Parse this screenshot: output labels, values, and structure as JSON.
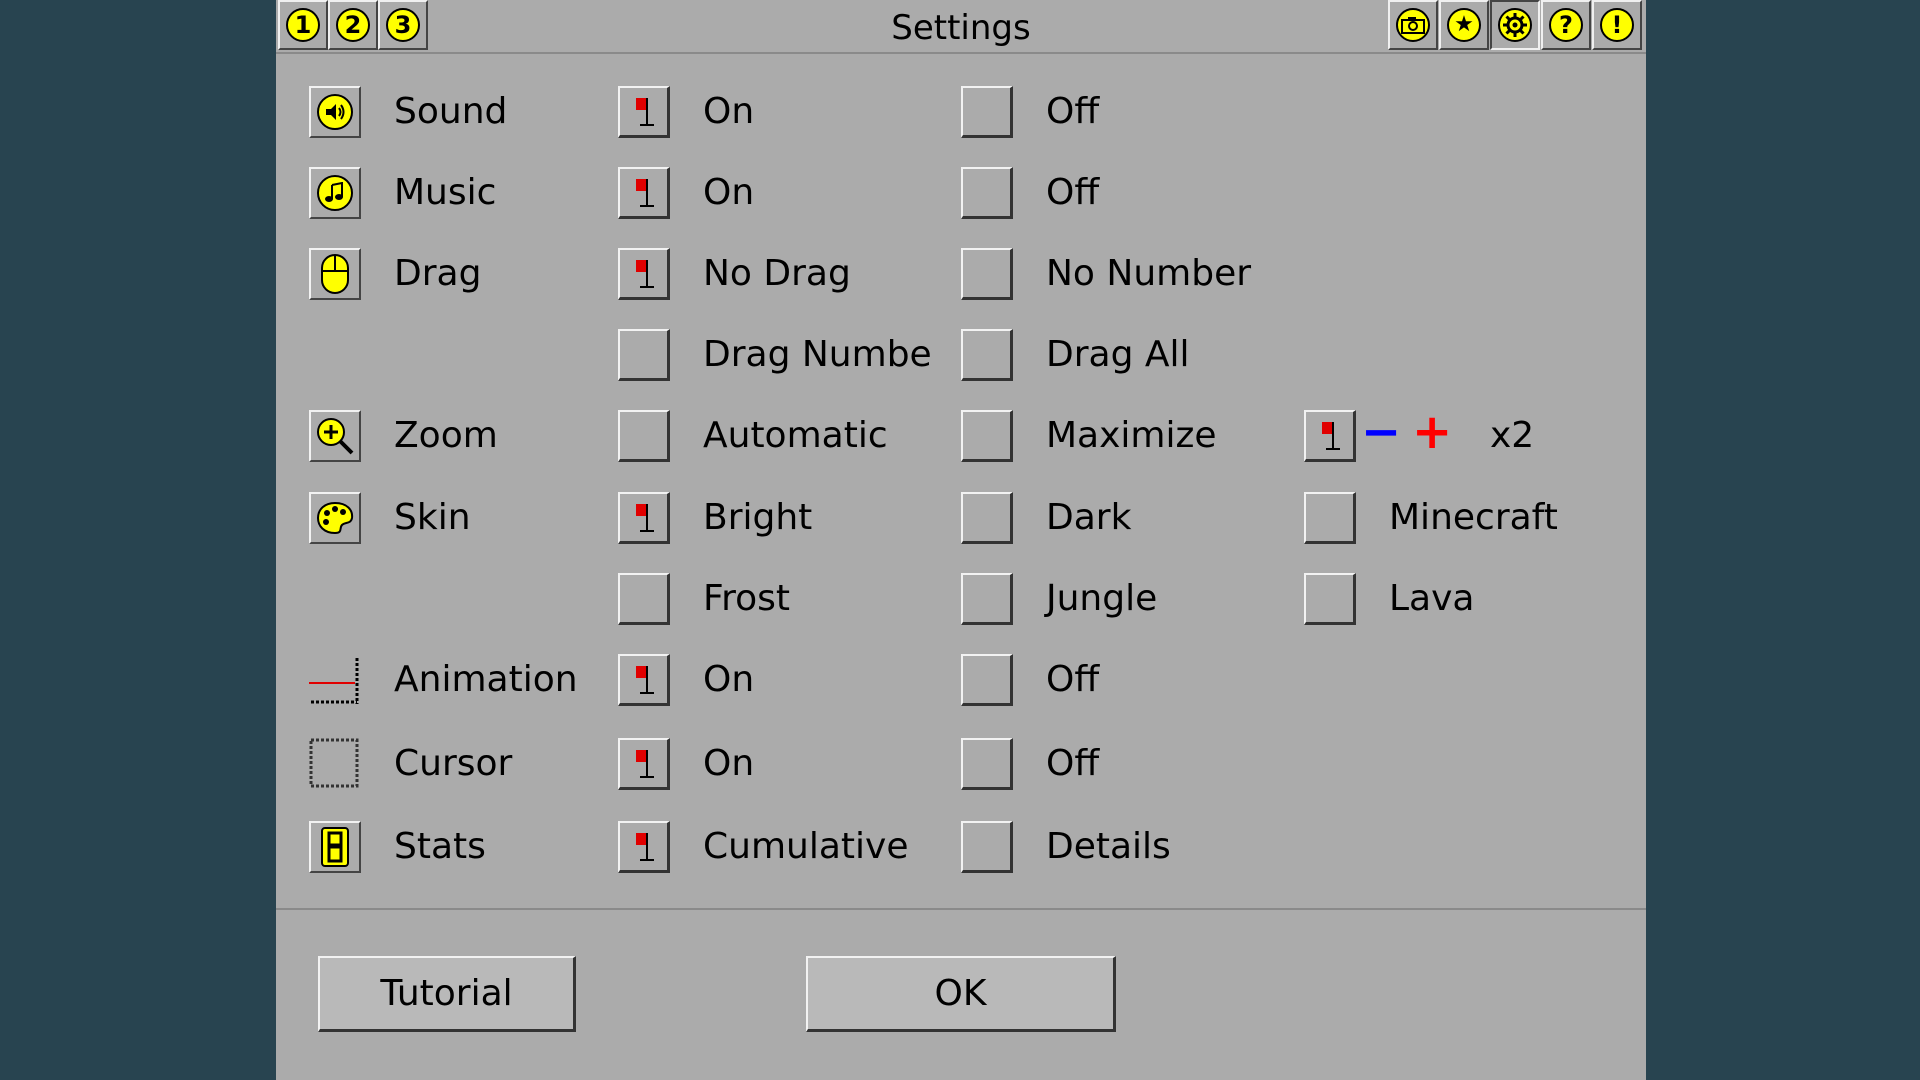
{
  "title": "Settings",
  "titlebar": {
    "left_buttons": [
      "1",
      "2",
      "3"
    ],
    "right_icons": [
      "camera-icon",
      "star-icon",
      "gear-icon",
      "help-icon",
      "alert-icon"
    ],
    "right_symbols": [
      "◎",
      "★",
      "✺",
      "?",
      "!"
    ]
  },
  "rows": {
    "sound": {
      "label": "Sound",
      "icon": "speaker-icon",
      "options": [
        {
          "label": "On",
          "checked": true
        },
        {
          "label": "Off",
          "checked": false
        }
      ]
    },
    "music": {
      "label": "Music",
      "icon": "music-note-icon",
      "options": [
        {
          "label": "On",
          "checked": true
        },
        {
          "label": "Off",
          "checked": false
        }
      ]
    },
    "drag": {
      "label": "Drag",
      "icon": "mouse-icon",
      "options": [
        {
          "label": "No Drag",
          "checked": true
        },
        {
          "label": "No Number",
          "checked": false
        },
        {
          "label": "Drag Numbe",
          "checked": false
        },
        {
          "label": "Drag All",
          "checked": false
        }
      ]
    },
    "zoom": {
      "label": "Zoom",
      "icon": "magnifier-icon",
      "options": [
        {
          "label": "Automatic",
          "checked": false
        },
        {
          "label": "Maximize",
          "checked": false
        },
        {
          "label": "",
          "checked": true
        }
      ],
      "minus": "−",
      "plus": "+",
      "value": "x2"
    },
    "skin": {
      "label": "Skin",
      "icon": "palette-icon",
      "options": [
        {
          "label": "Bright",
          "checked": true
        },
        {
          "label": "Dark",
          "checked": false
        },
        {
          "label": "Minecraft",
          "checked": false
        },
        {
          "label": "Frost",
          "checked": false
        },
        {
          "label": "Jungle",
          "checked": false
        },
        {
          "label": "Lava",
          "checked": false
        }
      ]
    },
    "animation": {
      "label": "Animation",
      "icon": "animation-icon",
      "options": [
        {
          "label": "On",
          "checked": true
        },
        {
          "label": "Off",
          "checked": false
        }
      ]
    },
    "cursor": {
      "label": "Cursor",
      "icon": "cursor-box-icon",
      "options": [
        {
          "label": "On",
          "checked": true
        },
        {
          "label": "Off",
          "checked": false
        }
      ]
    },
    "stats": {
      "label": "Stats",
      "icon": "digit-eight-icon",
      "options": [
        {
          "label": "Cumulative",
          "checked": true
        },
        {
          "label": "Details",
          "checked": false
        }
      ]
    }
  },
  "buttons": {
    "tutorial": "Tutorial",
    "ok": "OK"
  },
  "colors": {
    "panel": "#ababab",
    "background": "#284450",
    "accent_yellow": "#ffff00",
    "flag_red": "#e00000",
    "minus_blue": "#0000ff",
    "plus_red": "#ff0000"
  }
}
